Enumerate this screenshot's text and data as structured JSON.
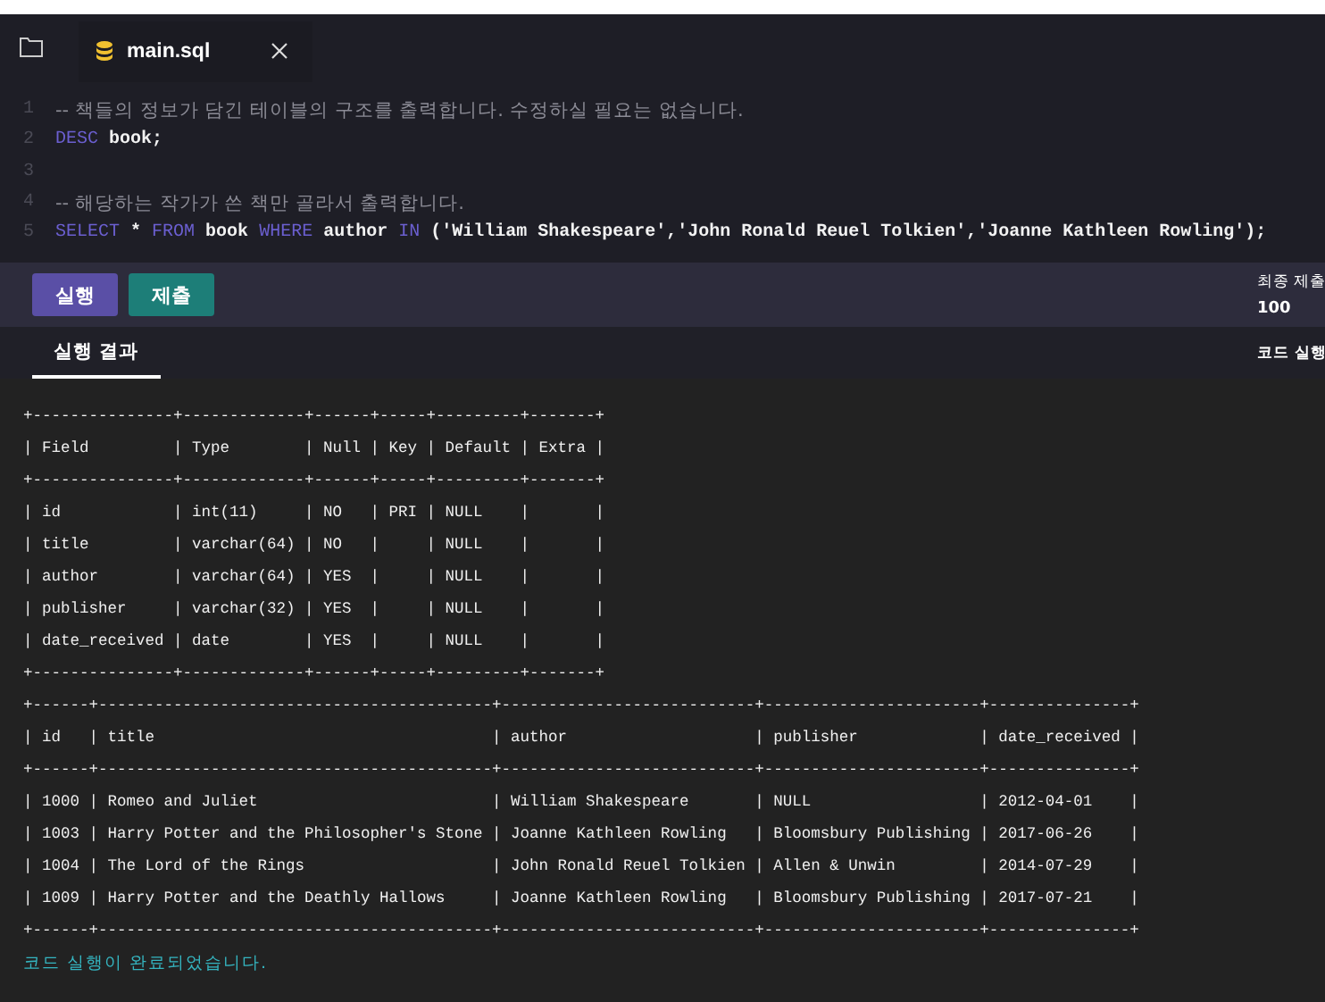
{
  "editor": {
    "tab": {
      "name": "main.sql"
    },
    "lines": [
      {
        "number": "1",
        "tokens": [
          {
            "kind": "comment",
            "text": "-- 책들의 정보가 담긴 테이블의 구조를 출력합니다. 수정하실 필요는 없습니다."
          }
        ]
      },
      {
        "number": "2",
        "tokens": [
          {
            "kind": "keyword",
            "text": "DESC"
          },
          {
            "kind": "text",
            "text": " book;"
          }
        ]
      },
      {
        "number": "3"
      },
      {
        "number": "4",
        "tokens": [
          {
            "kind": "comment",
            "text": "-- 해당하는 작가가 쓴 책만 골라서 출력합니다."
          }
        ]
      },
      {
        "number": "5",
        "tokens": [
          {
            "kind": "keyword",
            "text": "SELECT"
          },
          {
            "kind": "text",
            "text": " * "
          },
          {
            "kind": "keyword",
            "text": "FROM"
          },
          {
            "kind": "text",
            "text": " book "
          },
          {
            "kind": "keyword",
            "text": "WHERE"
          },
          {
            "kind": "text",
            "text": " author "
          },
          {
            "kind": "keyword",
            "text": "IN"
          },
          {
            "kind": "text",
            "text": " ('William Shakespeare','John Ronald Reuel Tolkien','Joanne Kathleen Rowling');"
          }
        ]
      }
    ]
  },
  "toolbar": {
    "buttons": [
      {
        "label": "실행",
        "kind": "run"
      },
      {
        "label": "제출",
        "kind": "submit"
      }
    ],
    "score": {
      "label": "최종 제출",
      "value": "100"
    }
  },
  "result_tabs": [
    {
      "label": "실행 결과",
      "selected": true
    }
  ],
  "result_status": "코드 실행",
  "output": {
    "lines": [
      {
        "kind": "table",
        "text": "+---------------+-------------+------+-----+---------+-------+"
      },
      {
        "kind": "table",
        "text": "| Field         | Type        | Null | Key | Default | Extra |"
      },
      {
        "kind": "table",
        "text": "+---------------+-------------+------+-----+---------+-------+"
      },
      {
        "kind": "table",
        "text": "| id            | int(11)     | NO   | PRI | NULL    |       |"
      },
      {
        "kind": "table",
        "text": "| title         | varchar(64) | NO   |     | NULL    |       |"
      },
      {
        "kind": "table",
        "text": "| author        | varchar(64) | YES  |     | NULL    |       |"
      },
      {
        "kind": "table",
        "text": "| publisher     | varchar(32) | YES  |     | NULL    |       |"
      },
      {
        "kind": "table",
        "text": "| date_received | date        | YES  |     | NULL    |       |"
      },
      {
        "kind": "table",
        "text": "+---------------+-------------+------+-----+---------+-------+"
      },
      {
        "kind": "table",
        "text": "+------+------------------------------------------+---------------------------+-----------------------+---------------+"
      },
      {
        "kind": "table",
        "text": "| id   | title                                    | author                    | publisher             | date_received |"
      },
      {
        "kind": "table",
        "text": "+------+------------------------------------------+---------------------------+-----------------------+---------------+"
      },
      {
        "kind": "table",
        "text": "| 1000 | Romeo and Juliet                         | William Shakespeare       | NULL                  | 2012-04-01    |"
      },
      {
        "kind": "table",
        "text": "| 1003 | Harry Potter and the Philosopher's Stone | Joanne Kathleen Rowling   | Bloomsbury Publishing | 2017-06-26    |"
      },
      {
        "kind": "table",
        "text": "| 1004 | The Lord of the Rings                    | John Ronald Reuel Tolkien | Allen & Unwin         | 2014-07-29    |"
      },
      {
        "kind": "table",
        "text": "| 1009 | Harry Potter and the Deathly Hallows     | Joanne Kathleen Rowling   | Bloomsbury Publishing | 2017-07-21    |"
      },
      {
        "kind": "table",
        "text": "+------+------------------------------------------+---------------------------+-----------------------+---------------+"
      },
      {
        "kind": "message",
        "text": "코드 실행이 완료되었습니다."
      }
    ]
  }
}
